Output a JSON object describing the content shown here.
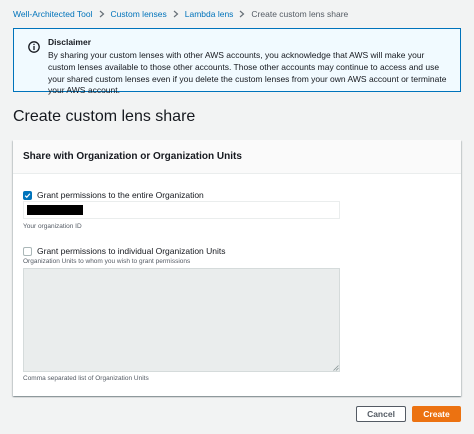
{
  "breadcrumb": {
    "items": [
      "Well-Architected Tool",
      "Custom lenses",
      "Lambda lens"
    ],
    "current": "Create custom lens share"
  },
  "disclaimer": {
    "icon": "info-icon",
    "title": "Disclaimer",
    "body": "By sharing your custom lenses with other AWS accounts, you acknowledge that AWS will make your custom lenses available to those other accounts. Those other accounts may continue to access and use your shared custom lenses even if you delete the custom lenses from your own AWS account or terminate your AWS account."
  },
  "page_title": "Create custom lens share",
  "share_panel": {
    "header": "Share with Organization or Organization Units",
    "org_option": {
      "label": "Grant permissions to the entire Organization",
      "checked": true,
      "helper": "Your organization ID"
    },
    "ou_option": {
      "label": "Grant permissions to individual Organization Units",
      "checked": false,
      "description": "Organization Units to whom you wish to grant permissions",
      "helper": "Comma separated list of Organization Units"
    }
  },
  "actions": {
    "cancel_label": "Cancel",
    "create_label": "Create"
  },
  "colors": {
    "link": "#0073bb",
    "primary": "#ec7211",
    "info_border": "#0073bb",
    "info_bg": "#f1faff"
  }
}
